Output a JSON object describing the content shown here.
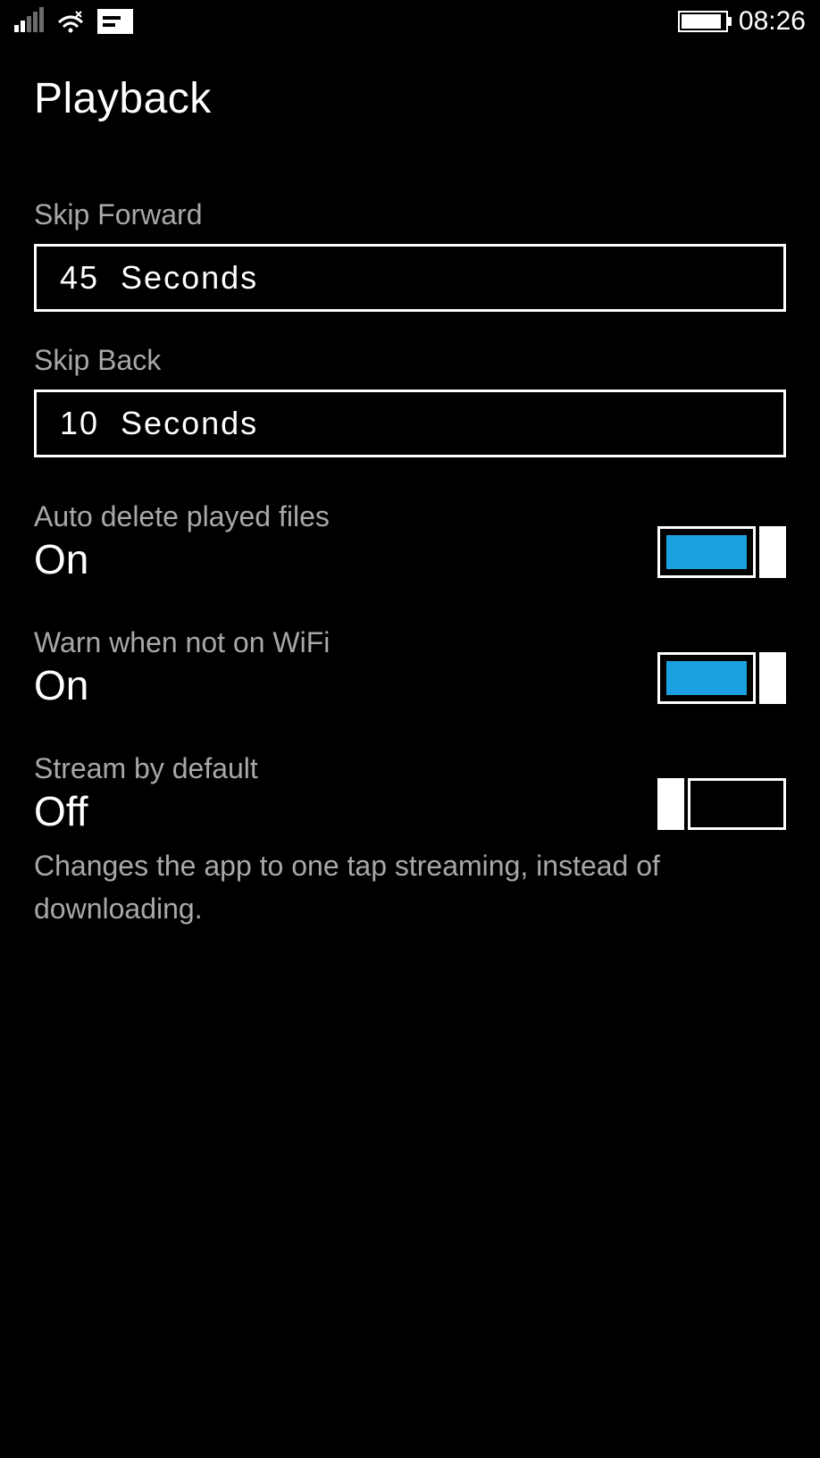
{
  "statusbar": {
    "clock": "08:26"
  },
  "page": {
    "title": "Playback"
  },
  "settings": {
    "skip_forward": {
      "label": "Skip Forward",
      "value": "45  Seconds"
    },
    "skip_back": {
      "label": "Skip Back",
      "value": "10  Seconds"
    },
    "auto_delete": {
      "label": "Auto delete played files",
      "value": "On",
      "on": true
    },
    "warn_wifi": {
      "label": "Warn when not on WiFi",
      "value": "On",
      "on": true
    },
    "stream_default": {
      "label": "Stream by default",
      "value": "Off",
      "on": false,
      "description": "Changes the app to one tap streaming, instead of downloading."
    }
  }
}
